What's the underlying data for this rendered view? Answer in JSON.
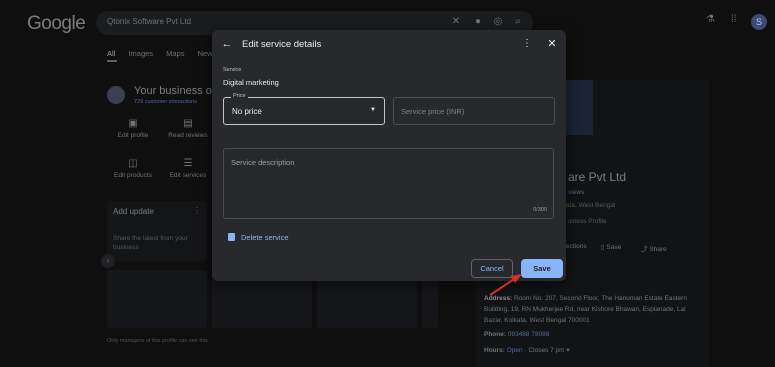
{
  "search": {
    "query": "Qtonix Software Pvt Ltd"
  },
  "google": {
    "logo": "Google",
    "avatar_letter": "S"
  },
  "tabs": [
    "All",
    "Images",
    "Maps",
    "News"
  ],
  "business": {
    "title": "Your business on",
    "subtitle": "729 customer interactions",
    "actions": [
      {
        "label": "Edit profile",
        "icon": "store-icon"
      },
      {
        "label": "Read reviews",
        "icon": "review-icon"
      },
      {
        "label": "Edit products",
        "icon": "bag-icon"
      },
      {
        "label": "Edit services",
        "icon": "list-icon"
      }
    ],
    "update_title": "Add update",
    "update_body": "Share the latest from your business",
    "footer_note": "Only managers of this profile can see this"
  },
  "profile_panel": {
    "name": "are Pvt Ltd",
    "reviews": "views",
    "location": "ata, West Bengal",
    "badge": "siness Profile",
    "directions": "ections",
    "save": "Save",
    "share": "Share",
    "address_label": "Address:",
    "address": "Room No. 207, Second Floor, The Hanuman Estate Eastern Building, 19, RN Mukherjee Rd, near Kishore Bhawan, Esplanade, Lal Bazar, Kolkata, West Bengal 700001",
    "phone_label": "Phone:",
    "phone": "093488 78088",
    "hours_label": "Hours:",
    "hours_status": "Open",
    "hours_close": "· Closes 7 pm ▾"
  },
  "modal": {
    "title": "Edit service details",
    "service_label": "Service",
    "service_value": "Digital marketing",
    "price_legend": "Price",
    "price_value": "No price",
    "service_price_placeholder": "Service price (INR)",
    "description_placeholder": "Service description",
    "char_count": "0/300",
    "delete_label": "Delete service",
    "cancel_label": "Cancel",
    "save_label": "Save"
  },
  "colors": {
    "accent": "#8ab4f8",
    "modal_bg": "#28292c",
    "page_bg": "#0f0f10",
    "arrow": "#d32f2f"
  }
}
